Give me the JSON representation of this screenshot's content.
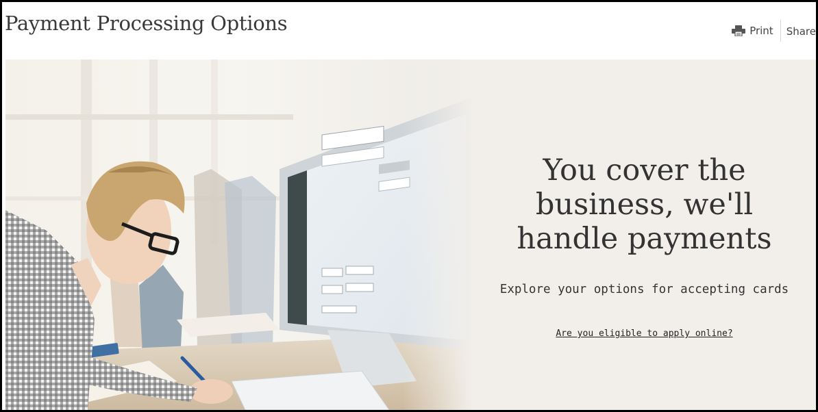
{
  "header": {
    "title": "Payment Processing Options",
    "print_label": "Print",
    "share_label": "Share"
  },
  "hero": {
    "heading_lines": [
      "You cover the",
      "business, we'll",
      "handle payments"
    ],
    "subtitle": "Explore your options for accepting cards",
    "link_label": "Are you eligible to apply online?",
    "image_icon": "woman-at-computer-photo"
  },
  "colors": {
    "frame_border": "#000000",
    "panel_background": "#f2efeb",
    "title_text": "#3a3a3a",
    "body_text": "#333333"
  },
  "icons": {
    "print": "printer-icon"
  }
}
